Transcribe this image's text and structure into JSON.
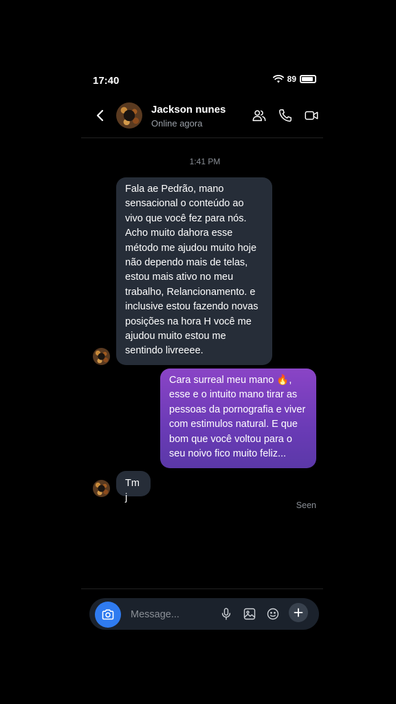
{
  "status_bar": {
    "time": "17:40",
    "battery": "89",
    "battery_level": 0.89
  },
  "header": {
    "contact_name": "Jackson nunes",
    "contact_status": "Online agora",
    "icons": [
      "back-icon",
      "group-icon",
      "phone-icon",
      "video-icon"
    ]
  },
  "chat": {
    "timestamp": "1:41 PM",
    "messages": [
      {
        "direction": "incoming",
        "text": "Fala ae Pedrão, mano sensacional o conteúdo ao vivo que você fez para nós. Acho muito dahora esse método me ajudou muito hoje não dependo mais de telas, estou mais ativo no meu trabalho, Relancionamento. e inclusive estou fazendo novas posições na hora H você me ajudou muito estou me sentindo livreeee."
      },
      {
        "direction": "outgoing",
        "text": "Cara surreal meu mano 🔥, esse e o intuito mano tirar as pessoas da pornografia e viver com estimulos natural. E que bom que você voltou para o seu noivo fico muito feliz..."
      },
      {
        "direction": "incoming",
        "text": "Tmj"
      }
    ],
    "seen_label": "Seen"
  },
  "composer": {
    "placeholder": "Message...",
    "icons": [
      "camera-icon",
      "microphone-icon",
      "image-icon",
      "emoji-icon",
      "plus-icon"
    ]
  },
  "colors": {
    "background": "#000000",
    "incoming_bubble": "#262d38",
    "outgoing_bubble_top": "#8a44c6",
    "outgoing_bubble_bottom": "#5b38a8",
    "camera_button": "#2f7bf0"
  }
}
